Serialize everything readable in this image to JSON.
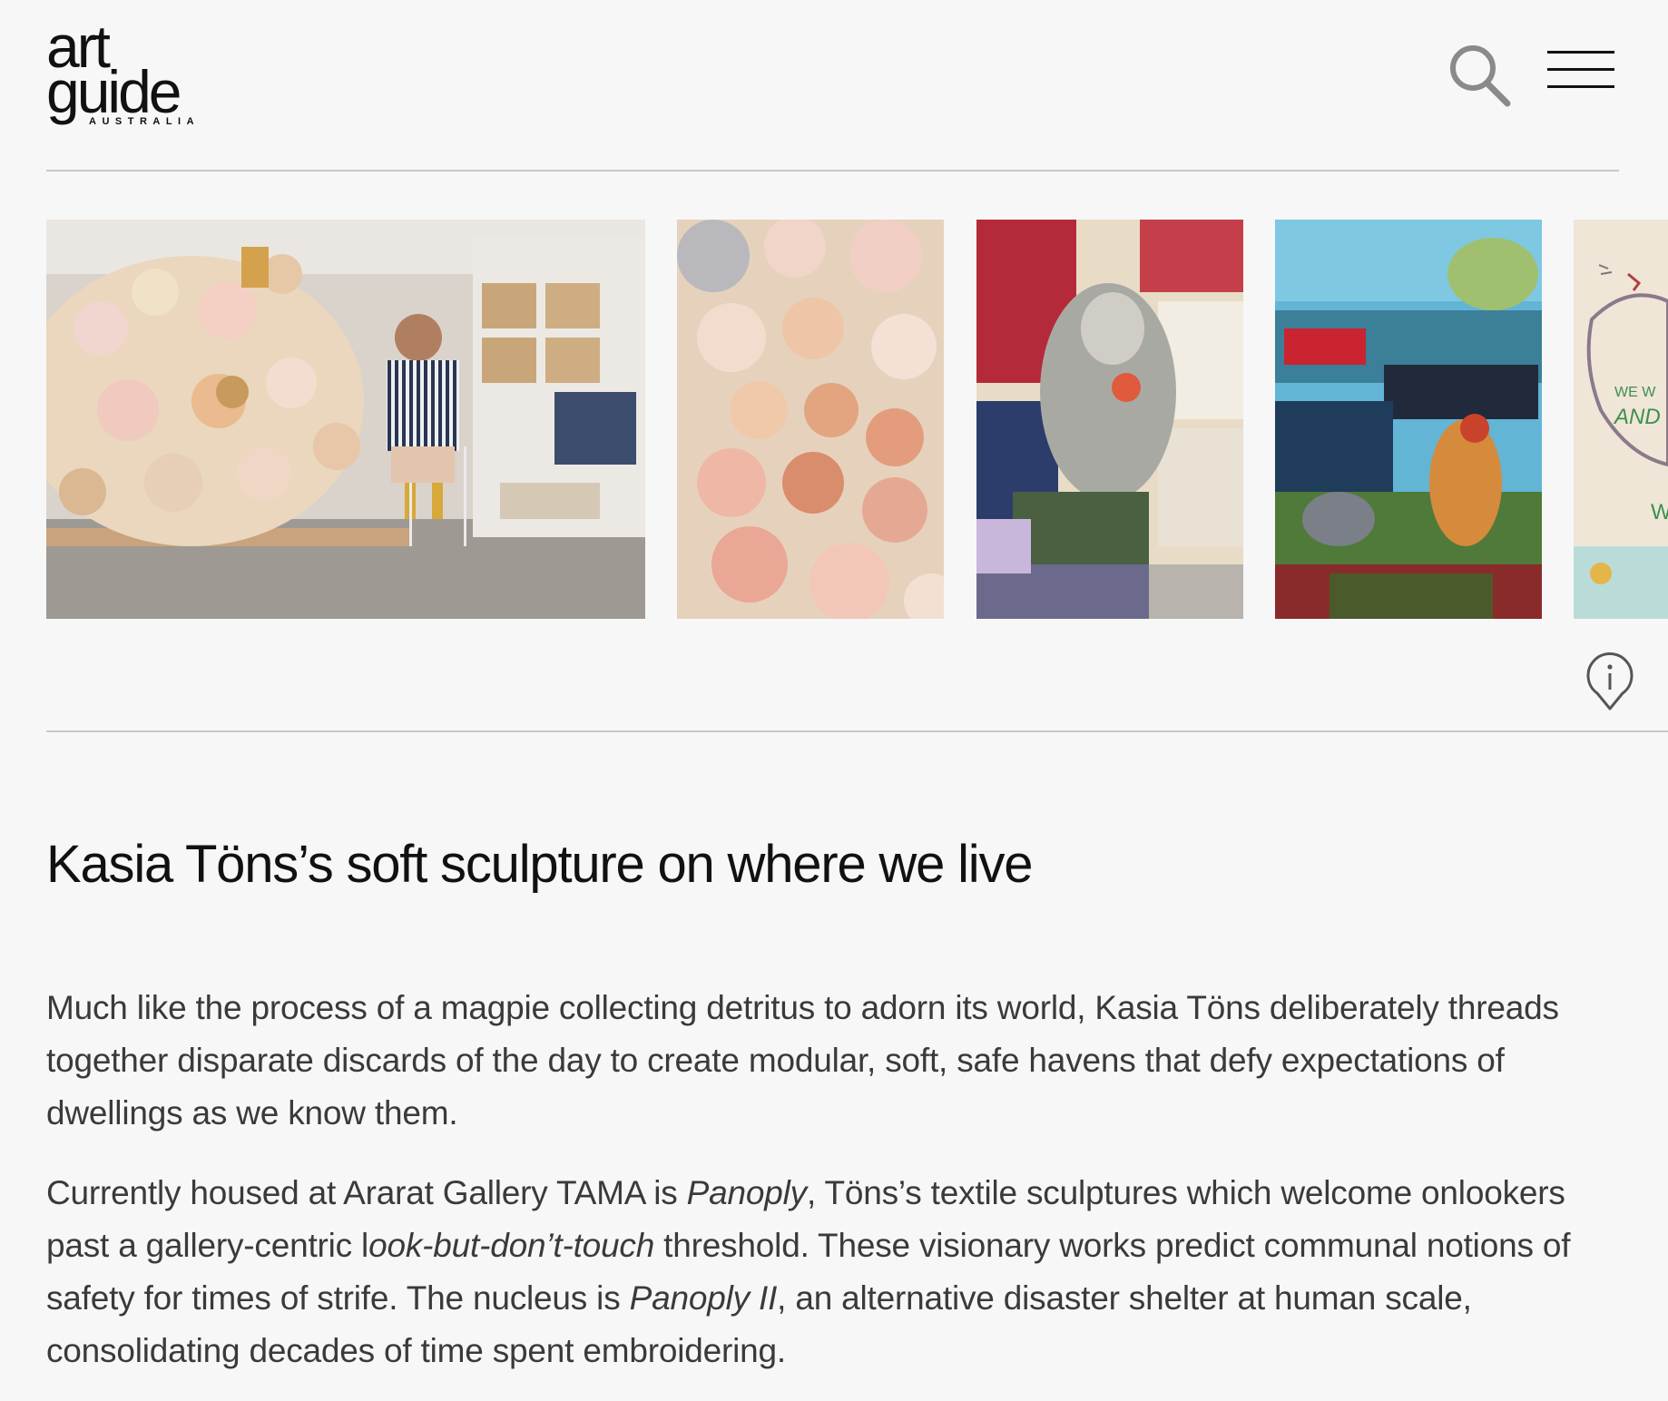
{
  "site": {
    "logo_line1": "art",
    "logo_line2": "guide",
    "logo_line3": "AUSTRALIA"
  },
  "header": {
    "search_icon": "search-icon",
    "menu_icon": "hamburger-menu-icon"
  },
  "gallery": {
    "images": [
      {
        "subject": "artist seated beside large soft sculpture in studio"
      },
      {
        "subject": "detail of stitched fabric pillows"
      },
      {
        "subject": "embroidered textile with figure"
      },
      {
        "subject": "embroidered textile landscape"
      },
      {
        "subject": "embroidered textile with lettering"
      }
    ],
    "partial_lettering": [
      "WE W",
      "AND",
      "W"
    ],
    "info_icon": "info-icon"
  },
  "article": {
    "title": "Kasia Töns’s soft sculpture on where we live",
    "p1": "Much like the process of a magpie collecting detritus to adorn its world, Kasia Töns deliberately threads together disparate discards of the day to create modular, soft, safe havens that defy expectations of dwellings as we know them.",
    "p2": {
      "s1": "Currently housed at Ararat Gallery TAMA is ",
      "i1": "Panoply",
      "s2": ", Töns’s textile sculptures which welcome onlookers past a gallery-centric l",
      "i2": "ook-but-don’t-touch",
      "s3": " threshold. These visionary works predict communal notions of safety for times of strife. The nucleus is ",
      "i3": "Panoply II",
      "s4": ", an alternative disaster shelter at human scale, consolidating decades of time spent embroidering."
    }
  },
  "colors": {
    "background": "#f7f7f7",
    "text": "#111111",
    "body_text": "#3a3a3a",
    "rule": "#c9c9c9"
  }
}
